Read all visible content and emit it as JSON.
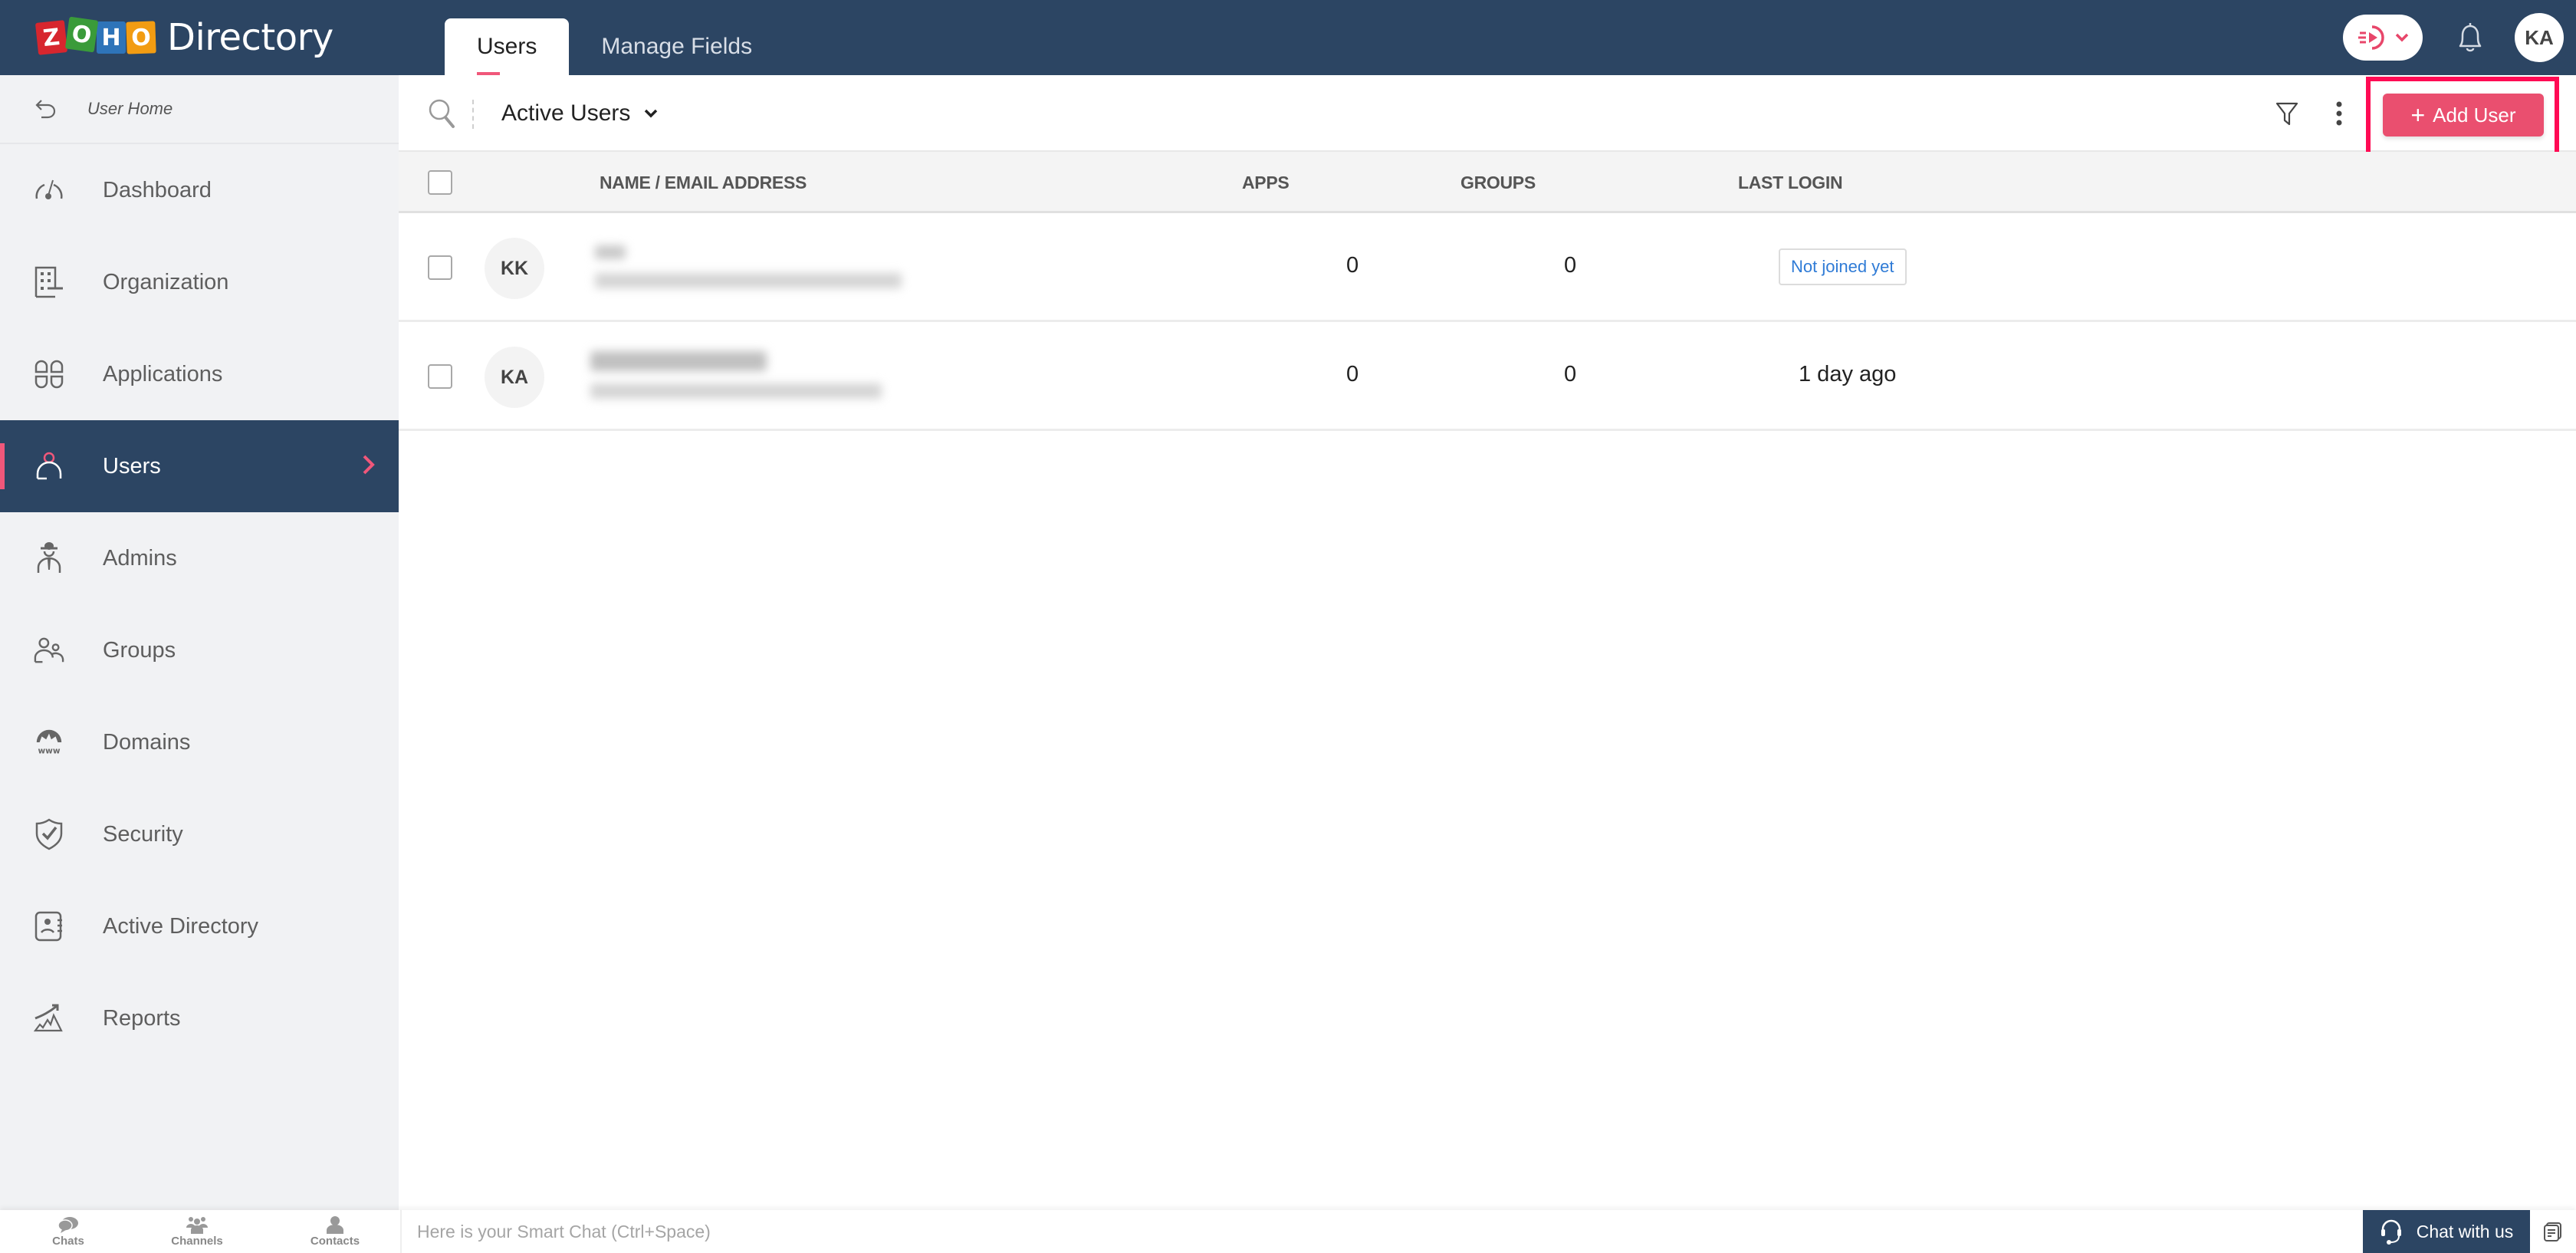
{
  "app": {
    "logo_letters": [
      "Z",
      "O",
      "H",
      "O"
    ],
    "product_name": "Directory"
  },
  "header": {
    "tabs": [
      {
        "label": "Users",
        "active": true
      },
      {
        "label": "Manage Fields",
        "active": false
      }
    ],
    "timer_icon": "play-timer-icon",
    "notification_icon": "bell-icon",
    "user_initials": "KA"
  },
  "sidebar": {
    "back_label": "User Home",
    "items": [
      {
        "label": "Dashboard",
        "icon": "speedometer-icon"
      },
      {
        "label": "Organization",
        "icon": "building-icon"
      },
      {
        "label": "Applications",
        "icon": "apps-grid-icon"
      },
      {
        "label": "Users",
        "icon": "user-icon",
        "active": true
      },
      {
        "label": "Admins",
        "icon": "admin-icon"
      },
      {
        "label": "Groups",
        "icon": "group-icon"
      },
      {
        "label": "Domains",
        "icon": "globe-www-icon"
      },
      {
        "label": "Security",
        "icon": "shield-check-icon"
      },
      {
        "label": "Active Directory",
        "icon": "contact-card-icon"
      },
      {
        "label": "Reports",
        "icon": "chart-trend-icon"
      }
    ]
  },
  "toolbar": {
    "view_selected": "Active Users",
    "add_user_label": "Add User",
    "accent_color": "#ea4f6f",
    "highlight_color": "#ff0a54"
  },
  "table": {
    "columns": [
      "NAME / EMAIL ADDRESS",
      "APPS",
      "GROUPS",
      "LAST LOGIN"
    ],
    "rows": [
      {
        "initials": "KK",
        "name": "[redacted]",
        "email": "[redacted]",
        "apps": "0",
        "groups": "0",
        "last_login": "Not joined yet",
        "last_login_is_badge": true
      },
      {
        "initials": "KA",
        "name": "[redacted]",
        "email": "[redacted]",
        "apps": "0",
        "groups": "0",
        "last_login": "1 day ago",
        "last_login_is_badge": false
      }
    ]
  },
  "bottombar": {
    "items": [
      {
        "label": "Chats",
        "icon": "chat-bubbles-icon"
      },
      {
        "label": "Channels",
        "icon": "channels-icon"
      },
      {
        "label": "Contacts",
        "icon": "contact-icon"
      }
    ],
    "smartchat_placeholder": "Here is your Smart Chat (Ctrl+Space)",
    "chat_with_us_label": "Chat with us"
  },
  "colors": {
    "header_bg": "#2c4563",
    "sidebar_bg": "#f1f2f4",
    "active_marker": "#f0577a",
    "badge_text": "#2f7bd6"
  }
}
